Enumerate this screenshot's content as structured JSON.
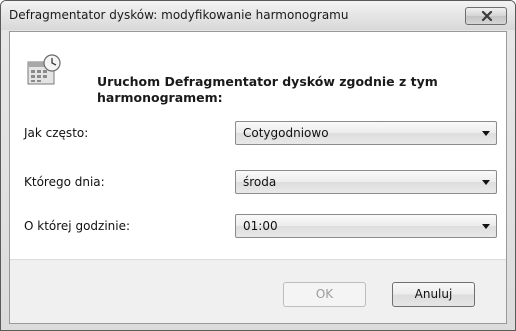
{
  "window": {
    "title": "Defragmentator dysków: modyfikowanie harmonogramu",
    "close_icon": "close-icon"
  },
  "header": {
    "icon": "calendar-clock-icon",
    "heading": "Uruchom Defragmentator dysków zgodnie z tym harmonogramem:"
  },
  "fields": [
    {
      "label": "Jak często:",
      "value": "Cotygodniowo"
    },
    {
      "label": "Którego dnia:",
      "value": "środa"
    },
    {
      "label": "O której godzinie:",
      "value": "01:00"
    }
  ],
  "buttons": {
    "ok_label": "OK",
    "ok_enabled": false,
    "cancel_label": "Anuluj"
  }
}
